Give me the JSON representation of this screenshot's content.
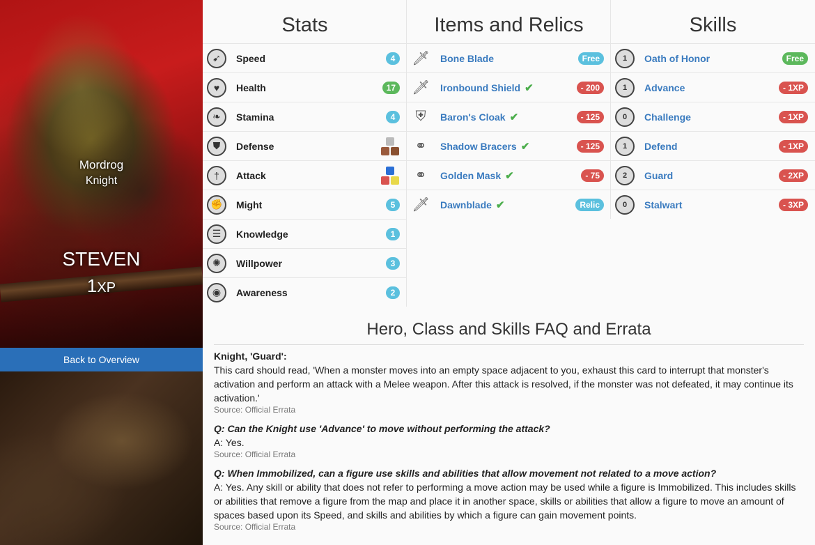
{
  "hero": {
    "name": "Mordrog",
    "class": "Knight"
  },
  "player": {
    "name": "STEVEN",
    "xp_num": "1",
    "xp_unit": "XP"
  },
  "nav": {
    "back_label": "Back to Overview"
  },
  "stats": {
    "title": "Stats",
    "rows": [
      {
        "label": "Speed",
        "value": "4",
        "icon": "speed-icon",
        "glyph": "➹"
      },
      {
        "label": "Health",
        "value": "17",
        "icon": "heart-icon",
        "glyph": "♥"
      },
      {
        "label": "Stamina",
        "value": "4",
        "icon": "stamina-icon",
        "glyph": "❧"
      },
      {
        "label": "Defense",
        "value": "",
        "icon": "shield-icon",
        "glyph": "⛊"
      },
      {
        "label": "Attack",
        "value": "",
        "icon": "sword-icon",
        "glyph": "†"
      },
      {
        "label": "Might",
        "value": "5",
        "icon": "fist-icon",
        "glyph": "✊"
      },
      {
        "label": "Knowledge",
        "value": "1",
        "icon": "book-icon",
        "glyph": "☰"
      },
      {
        "label": "Willpower",
        "value": "3",
        "icon": "willpower-icon",
        "glyph": "✺"
      },
      {
        "label": "Awareness",
        "value": "2",
        "icon": "eye-icon",
        "glyph": "◉"
      }
    ],
    "defense_dice": [
      "#bbbbbb",
      "#9a5a3c",
      "#8a5030"
    ],
    "attack_dice": [
      "#2a6fd6",
      "#d9534f",
      "#e8d84a"
    ]
  },
  "items": {
    "title": "Items and Relics",
    "rows": [
      {
        "label": "Bone Blade",
        "badge": "Free",
        "check": false,
        "icon": "sword-item-icon",
        "glyph": "🗡"
      },
      {
        "label": "Ironbound Shield",
        "badge": "- 200",
        "check": true,
        "icon": "shield-item-icon",
        "glyph": "🗡"
      },
      {
        "label": "Baron's Cloak",
        "badge": "- 125",
        "check": true,
        "icon": "armor-item-icon",
        "glyph": "⛨"
      },
      {
        "label": "Shadow Bracers",
        "badge": "- 125",
        "check": true,
        "icon": "ring-item-icon",
        "glyph": "⚭"
      },
      {
        "label": "Golden Mask",
        "badge": "- 75",
        "check": true,
        "icon": "ring-item-icon",
        "glyph": "⚭"
      },
      {
        "label": "Dawnblade",
        "badge": "Relic",
        "check": true,
        "icon": "sword-item-icon",
        "glyph": "🗡"
      }
    ]
  },
  "skills": {
    "title": "Skills",
    "rows": [
      {
        "label": "Oath of Honor",
        "badge": "Free",
        "cost": "1"
      },
      {
        "label": "Advance",
        "badge": "- 1XP",
        "cost": "1"
      },
      {
        "label": "Challenge",
        "badge": "- 1XP",
        "cost": "0"
      },
      {
        "label": "Defend",
        "badge": "- 1XP",
        "cost": "1"
      },
      {
        "label": "Guard",
        "badge": "- 2XP",
        "cost": "2"
      },
      {
        "label": "Stalwart",
        "badge": "- 3XP",
        "cost": "0"
      }
    ]
  },
  "faq": {
    "title": "Hero, Class and Skills FAQ and Errata",
    "entries": [
      {
        "q": "Knight, 'Guard':",
        "italic": false,
        "a": "This card should read, 'When a monster moves into an empty space adjacent to you, exhaust this card to interrupt that monster's activation and perform an attack with a Melee weapon. After this attack is resolved, if the monster was not defeated, it may continue its activation.'",
        "src": "Source: Official Errata"
      },
      {
        "q": "Q: Can the Knight use 'Advance' to move without performing the attack?",
        "italic": true,
        "a": "A: Yes.",
        "src": "Source: Official Errata"
      },
      {
        "q": "Q: When Immobilized, can a figure use skills and abilities that allow movement not related to a move action?",
        "italic": true,
        "a": "A: Yes. Any skill or ability that does not refer to performing a move action may be used while a figure is Immobilized. This includes skills or abilities that remove a figure from the map and place it in another space, skills or abilities that allow a figure to move an amount of spaces based upon its Speed, and skills and abilities by which a figure can gain movement points.",
        "src": "Source: Official Errata"
      }
    ]
  },
  "colors": {
    "accent_blue": "#2a6fb8",
    "badge_blue": "#5bc0de",
    "badge_green": "#5cb85c",
    "badge_red": "#d9534f",
    "link": "#3a7bbf",
    "check": "#4cae4c"
  }
}
